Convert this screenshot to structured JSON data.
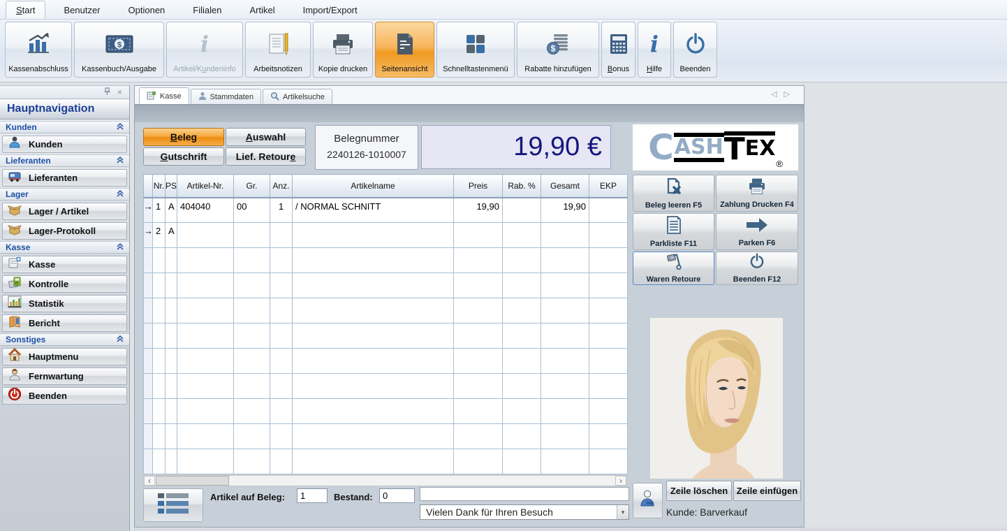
{
  "menu": {
    "items": [
      {
        "key": "S",
        "rest": "tart"
      },
      {
        "label": "Benutzer"
      },
      {
        "label": "Optionen"
      },
      {
        "label": "Filialen"
      },
      {
        "label": "Artikel"
      },
      {
        "label": "Import/Export"
      }
    ]
  },
  "ribbon": {
    "kassenabschluss": "Kassenabschluss",
    "kassenbuch": "Kassenbuch/Ausgabe",
    "kundeninfo_pre": "Artikel/K",
    "kundeninfo_key": "u",
    "kundeninfo_post": "ndeninfo",
    "arbeitsnotizen": "Arbeitsnotizen",
    "kopie_drucken": "Kopie drucken",
    "seitenansicht": "Seitenansicht",
    "schnelltasten": "Schnelltastenmenü",
    "rabatte": "Rabatte hinzufügen",
    "bonus_key": "B",
    "bonus_post": "onus",
    "hilfe_key": "H",
    "hilfe_post": "ilfe",
    "beenden": "Beenden"
  },
  "sidebar": {
    "title": "Hauptnavigation",
    "sections": [
      {
        "header": "Kunden",
        "items": [
          {
            "label": "Kunden"
          }
        ]
      },
      {
        "header": "Lieferanten",
        "items": [
          {
            "label": "Lieferanten"
          }
        ]
      },
      {
        "header": "Lager",
        "items": [
          {
            "label": "Lager / Artikel"
          },
          {
            "label": "Lager-Protokoll"
          }
        ]
      },
      {
        "header": "Kasse",
        "items": [
          {
            "label": "Kasse"
          },
          {
            "label": "Kontrolle"
          },
          {
            "label": "Statistik"
          },
          {
            "label": "Bericht"
          }
        ]
      },
      {
        "header": "Sonstiges",
        "items": [
          {
            "label": "Hauptmenu"
          },
          {
            "label": "Fernwartung"
          },
          {
            "label": "Beenden"
          }
        ]
      }
    ]
  },
  "tabs": [
    {
      "label": "Kasse"
    },
    {
      "label": "Stammdaten"
    },
    {
      "label": "Artikelsuche"
    }
  ],
  "pos": {
    "beleg_key": "B",
    "beleg_rest": "eleg",
    "auswahl_key": "A",
    "auswahl_rest": "uswahl",
    "gutschrift_key": "G",
    "gutschrift_rest": "utschrift",
    "lief_pre": "Lief. Retour",
    "lief_key": "e",
    "belegnummer_label": "Belegnummer",
    "belegnummer_value": "2240126-1010007",
    "total_display": "19,90 €"
  },
  "brand": {
    "c": "C",
    "ash": "ASH",
    "t": "T",
    "ex": "EX",
    "registered": "®"
  },
  "receipt_table": {
    "columns": [
      "Nr.",
      "PS",
      "Artikel-Nr.",
      "Gr.",
      "Anz.",
      "Artikelname",
      "Preis",
      "Rab. %",
      "Gesamt",
      "EKP"
    ],
    "rows": [
      {
        "marker": "→",
        "nr": "1",
        "ps": "A",
        "artikel_nr": "404040",
        "gr": "00",
        "anz": "1",
        "artikelname": "/ NORMAL SCHNITT",
        "preis": "19,90",
        "rab": "",
        "gesamt": "19,90",
        "ekp": ""
      },
      {
        "marker": "→",
        "nr": "2",
        "ps": "A",
        "artikel_nr": "",
        "gr": "",
        "anz": "",
        "artikelname": "",
        "preis": "",
        "rab": "",
        "gesamt": "",
        "ekp": ""
      }
    ]
  },
  "actions": {
    "beleg_leeren": "Beleg leeren F5",
    "zahlung_drucken": "Zahlung Drucken F4",
    "parkliste": "Parkliste F11",
    "parken": "Parken F6",
    "waren_retoure": "Waren Retoure",
    "beenden": "Beenden  F12"
  },
  "footer": {
    "artikel_auf_beleg_label": "Artikel auf Beleg:",
    "artikel_auf_beleg_value": "1",
    "bestand_label": "Bestand:",
    "bestand_value": "0",
    "message_value": "",
    "greeting": "Vielen Dank für Ihren Besuch",
    "zeile_loeschen": "Zeile löschen",
    "zeile_einfuegen": "Zeile einfügen",
    "kunde": "Kunde: Barverkauf"
  },
  "glyphs": {
    "close": "×",
    "tab_prev": "◁",
    "tab_next": "▷",
    "scroll_left": "‹",
    "scroll_right": "›",
    "dropdown_arrow": "▾"
  },
  "colors": {
    "accent_orange": "#f6a93f",
    "price_navy": "#16167e",
    "brand_blue": "#93abc6",
    "grid_line": "#a9bed3",
    "section_header_blue": "#1e50a5"
  }
}
